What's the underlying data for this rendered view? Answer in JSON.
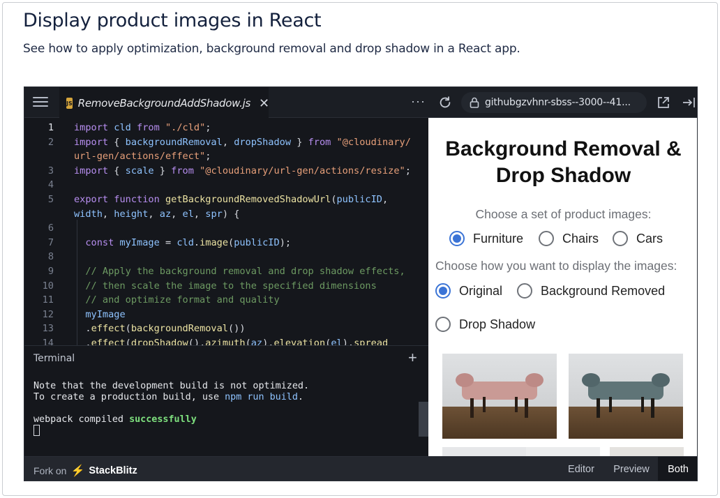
{
  "page": {
    "title": "Display product images in React",
    "subtitle": "See how to apply optimization, background removal and drop shadow in a React app."
  },
  "topbar": {
    "file_badge": "JS",
    "file_name": "RemoveBackgroundAddShadow.js",
    "close_glyph": "✕",
    "more_glyph": "···",
    "url": "githubgzvhnr-sbss--3000--41..."
  },
  "editor": {
    "lines": [
      {
        "no": "1",
        "tokens": [
          [
            "kw",
            "import "
          ],
          [
            "id",
            "cld "
          ],
          [
            "kw",
            "from "
          ],
          [
            "str",
            "\"./cld\""
          ],
          [
            "pun",
            ";"
          ]
        ]
      },
      {
        "no": "2",
        "tokens": [
          [
            "kw",
            "import "
          ],
          [
            "pun",
            "{ "
          ],
          [
            "id",
            "backgroundRemoval"
          ],
          [
            "pun",
            ", "
          ],
          [
            "id",
            "dropShadow "
          ],
          [
            "pun",
            "} "
          ],
          [
            "kw",
            "from "
          ],
          [
            "str",
            "\"@cloudinary/"
          ]
        ]
      },
      {
        "no": "",
        "tokens": [
          [
            "str",
            "url-gen/actions/effect\""
          ],
          [
            "pun",
            ";"
          ]
        ]
      },
      {
        "no": "3",
        "tokens": [
          [
            "kw",
            "import "
          ],
          [
            "pun",
            "{ "
          ],
          [
            "id",
            "scale "
          ],
          [
            "pun",
            "} "
          ],
          [
            "kw",
            "from "
          ],
          [
            "str",
            "\"@cloudinary/url-gen/actions/resize\""
          ],
          [
            "pun",
            ";"
          ]
        ]
      },
      {
        "no": "4",
        "tokens": []
      },
      {
        "no": "5",
        "tokens": [
          [
            "kw",
            "export "
          ],
          [
            "kw",
            "function "
          ],
          [
            "fn",
            "getBackgroundRemovedShadowUrl"
          ],
          [
            "pun",
            "("
          ],
          [
            "id",
            "publicID"
          ],
          [
            "pun",
            ","
          ]
        ]
      },
      {
        "no": "",
        "tokens": [
          [
            "id",
            "width"
          ],
          [
            "pun",
            ", "
          ],
          [
            "id",
            "height"
          ],
          [
            "pun",
            ", "
          ],
          [
            "id",
            "az"
          ],
          [
            "pun",
            ", "
          ],
          [
            "id",
            "el"
          ],
          [
            "pun",
            ", "
          ],
          [
            "id",
            "spr"
          ],
          [
            "pun",
            ") {"
          ]
        ]
      },
      {
        "no": "6",
        "tokens": []
      },
      {
        "no": "7",
        "tokens": [
          [
            "pun",
            "  "
          ],
          [
            "kw",
            "const "
          ],
          [
            "id",
            "myImage "
          ],
          [
            "pun",
            "= "
          ],
          [
            "id",
            "cld"
          ],
          [
            "pun",
            "."
          ],
          [
            "fn",
            "image"
          ],
          [
            "pun",
            "("
          ],
          [
            "id",
            "publicID"
          ],
          [
            "pun",
            ");"
          ]
        ]
      },
      {
        "no": "8",
        "tokens": []
      },
      {
        "no": "9",
        "tokens": [
          [
            "cmt",
            "  // Apply the background removal and drop shadow effects,"
          ]
        ]
      },
      {
        "no": "10",
        "tokens": [
          [
            "cmt",
            "  // then scale the image to the specified dimensions"
          ]
        ]
      },
      {
        "no": "11",
        "tokens": [
          [
            "cmt",
            "  // and optimize format and quality"
          ]
        ]
      },
      {
        "no": "12",
        "tokens": [
          [
            "id",
            "  myImage"
          ]
        ]
      },
      {
        "no": "13",
        "tokens": [
          [
            "pun",
            "  ."
          ],
          [
            "fn",
            "effect"
          ],
          [
            "pun",
            "("
          ],
          [
            "fn",
            "backgroundRemoval"
          ],
          [
            "pun",
            "())"
          ]
        ]
      },
      {
        "no": "14",
        "tokens": [
          [
            "pun",
            "  ."
          ],
          [
            "fn",
            "effect"
          ],
          [
            "pun",
            "("
          ],
          [
            "fn",
            "dropShadow"
          ],
          [
            "pun",
            "()."
          ],
          [
            "fn",
            "azimuth"
          ],
          [
            "pun",
            "("
          ],
          [
            "id",
            "az"
          ],
          [
            "pun",
            ")."
          ],
          [
            "fn",
            "elevation"
          ],
          [
            "pun",
            "("
          ],
          [
            "id",
            "el"
          ],
          [
            "pun",
            ")."
          ],
          [
            "fn",
            "spread"
          ]
        ]
      }
    ]
  },
  "terminal": {
    "title": "Terminal",
    "plus": "+",
    "line1": "Note that the development build is not optimized.",
    "line2_pre": "To create a production build, use ",
    "line2_cmd": "npm run build",
    "line2_post": ".",
    "line3_pre": "webpack compiled ",
    "line3_ok": "successfully"
  },
  "preview": {
    "title": "Background Removal & Drop Shadow",
    "q1": "Choose a set of product images:",
    "sets": [
      {
        "label": "Furniture",
        "checked": true
      },
      {
        "label": "Chairs",
        "checked": false
      },
      {
        "label": "Cars",
        "checked": false
      }
    ],
    "q2": "Choose how you want to display the images:",
    "modes": [
      {
        "label": "Original",
        "checked": true
      },
      {
        "label": "Background Removed",
        "checked": false
      },
      {
        "label": "Drop Shadow",
        "checked": false
      }
    ]
  },
  "bottombar": {
    "fork_label": "Fork on",
    "brand": "StackBlitz",
    "views": [
      "Editor",
      "Preview",
      "Both"
    ],
    "active_view": "Both"
  },
  "colors": {
    "accent": "#3b74d6",
    "bench_pink": "#c99a95",
    "bench_teal": "#5f7477"
  }
}
